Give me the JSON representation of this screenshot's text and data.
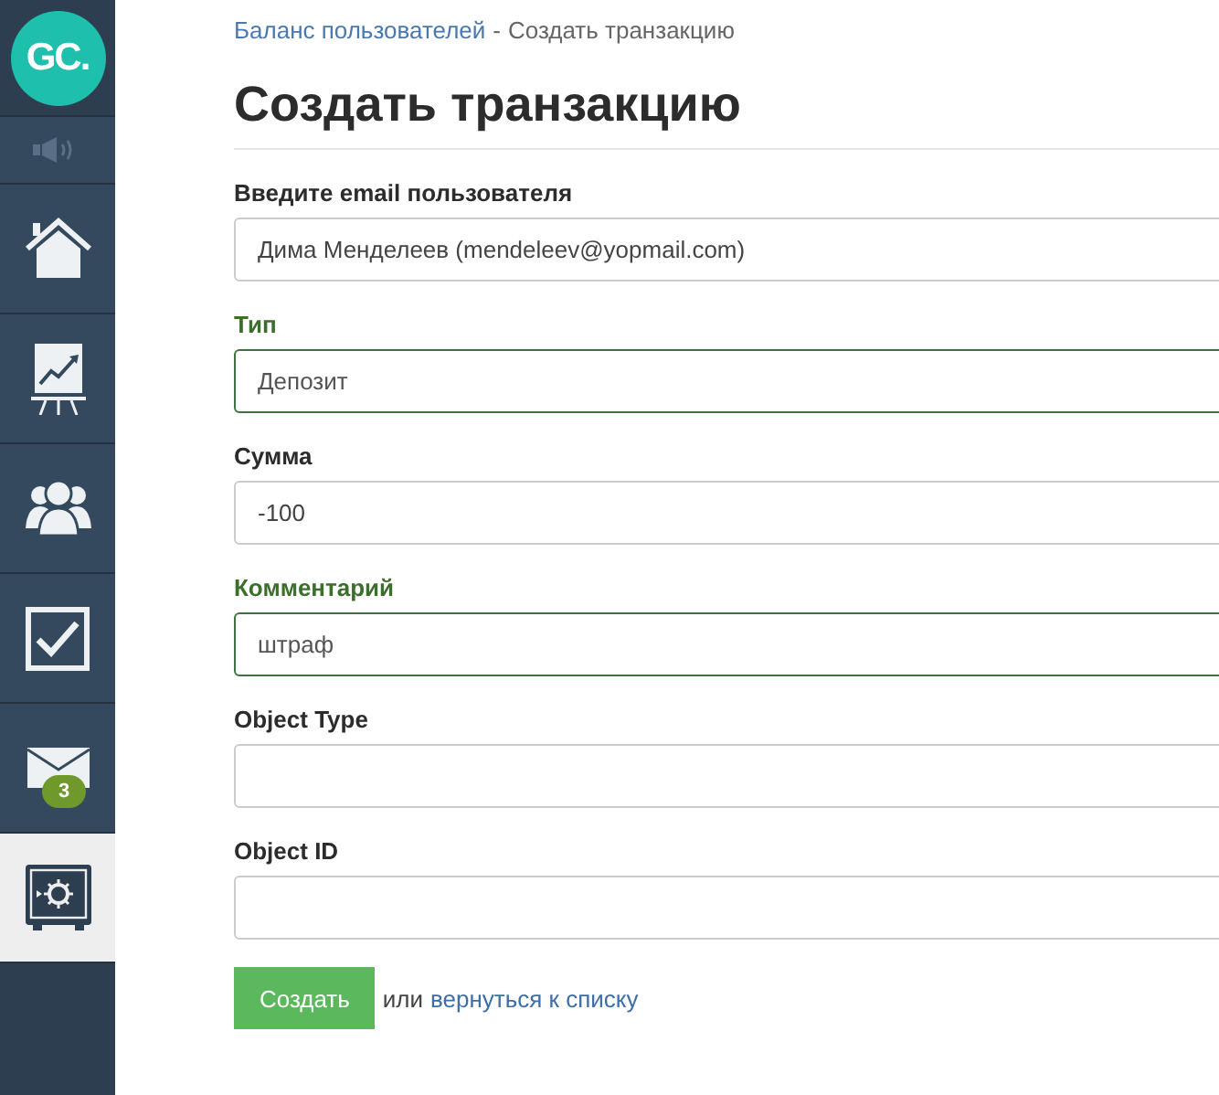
{
  "sidebar": {
    "logo": "GC.",
    "items": [
      {
        "kind": "sound",
        "selected": false
      },
      {
        "kind": "home",
        "selected": false
      },
      {
        "kind": "chart",
        "selected": false
      },
      {
        "kind": "users",
        "selected": false
      },
      {
        "kind": "tasks",
        "selected": false
      },
      {
        "kind": "mail",
        "selected": false,
        "badge": "3"
      },
      {
        "kind": "safe",
        "selected": true
      }
    ]
  },
  "breadcrumb": {
    "link": "Баланс пользователей",
    "separator": "-",
    "current": "Создать транзакцию"
  },
  "title": "Создать транзакцию",
  "fields": [
    {
      "label": "Введите email пользователя",
      "value": "Дима Менделеев (mendeleev@yopmail.com)",
      "valid": false
    },
    {
      "label": "Тип",
      "value": "Депозит",
      "valid": true
    },
    {
      "label": "Сумма",
      "value": "-100",
      "valid": false
    },
    {
      "label": "Комментарий",
      "value": "штраф",
      "valid": true
    },
    {
      "label": "Object Type",
      "valid": false
    },
    {
      "label": "Object ID",
      "valid": false
    }
  ],
  "actions": {
    "submit": "Создать",
    "or": "или",
    "back_link": "вернуться к списку"
  }
}
